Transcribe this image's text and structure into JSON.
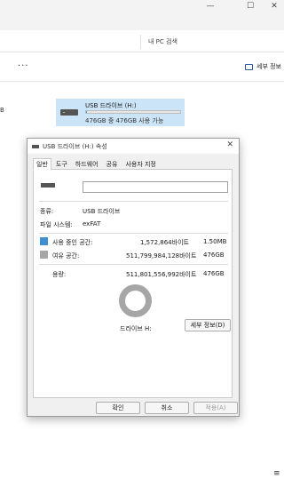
{
  "window": {
    "minimize": "—",
    "maximize": "☐",
    "close": "✕"
  },
  "search": {
    "placeholder": "내 PC 검색"
  },
  "toolbar": {
    "more": "···",
    "details_label": "세부 정보"
  },
  "left_mark": "B",
  "drive_tile": {
    "name": "USB 드라이브 (H:)",
    "free_text": "476GB 중 476GB 사용 가능",
    "used_fraction": 0.003
  },
  "dialog": {
    "title": "USB 드라이브 (H:) 속성",
    "close": "✕",
    "tabs": [
      "일반",
      "도구",
      "하드웨어",
      "공유",
      "사용자 지정"
    ],
    "name_value": "",
    "type_label": "종류:",
    "type_value": "USB 드라이브",
    "fs_label": "파일 시스템:",
    "fs_value": "exFAT",
    "used_label": "사용 중인 공간:",
    "used_bytes": "1,572,864바이트",
    "used_size": "1.50MB",
    "free_label": "여유 공간:",
    "free_bytes": "511,799,984,128바이트",
    "free_size": "476GB",
    "capacity_label": "용량:",
    "capacity_bytes": "511,801,556,992바이트",
    "capacity_size": "476GB",
    "drive_label": "드라이브 H:",
    "details_button": "세부 정보(D)",
    "ok": "확인",
    "cancel": "취소",
    "apply": "적용(A)"
  },
  "colors": {
    "used": "#3f8fd2",
    "free": "#a6a6a6",
    "selection": "#cce4f7"
  },
  "footer_icon": "≡"
}
